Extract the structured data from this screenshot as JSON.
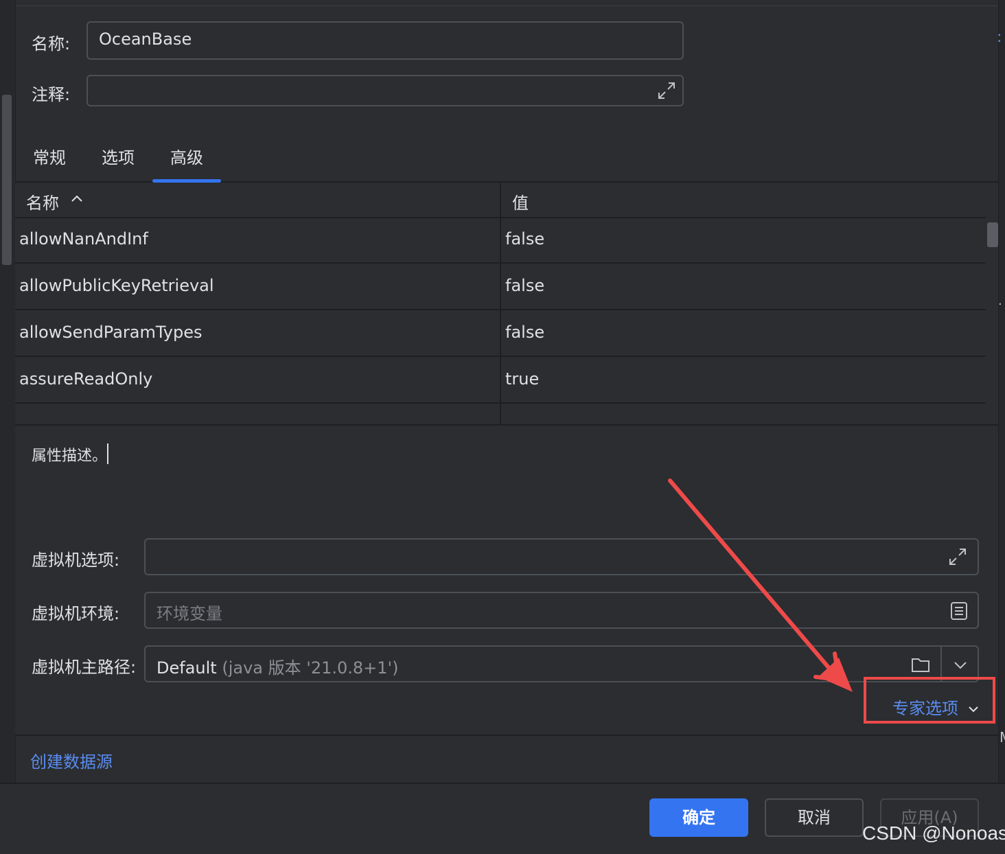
{
  "header": {
    "name_label": "名称:",
    "name_value": "OceanBase",
    "comment_label": "注释:",
    "comment_value": ""
  },
  "tabs": [
    {
      "label": "常规",
      "active": false
    },
    {
      "label": "选项",
      "active": false
    },
    {
      "label": "高级",
      "active": true
    }
  ],
  "table": {
    "columns": [
      "名称",
      "值"
    ],
    "rows": [
      {
        "name": "allowNanAndInf",
        "value": "false"
      },
      {
        "name": "allowPublicKeyRetrieval",
        "value": "false"
      },
      {
        "name": "allowSendParamTypes",
        "value": "false"
      },
      {
        "name": "assureReadOnly",
        "value": "true"
      }
    ]
  },
  "description": "属性描述。",
  "vm": {
    "options_label": "虚拟机选项:",
    "options_value": "",
    "env_label": "虚拟机环境:",
    "env_placeholder": "环境变量",
    "home_label": "虚拟机主路径:",
    "home_value": "Default",
    "home_note": "(java 版本 '21.0.8+1')"
  },
  "expert_options": "专家选项",
  "create_datasource": "创建数据源",
  "buttons": {
    "ok": "确定",
    "cancel": "取消",
    "apply": "应用(A)"
  },
  "watermark": "CSDN @Nonoas",
  "colors": {
    "background": "#2b2d30",
    "accent": "#3574f0",
    "link": "#5b8cf0",
    "annotation": "#ee4a4a"
  }
}
